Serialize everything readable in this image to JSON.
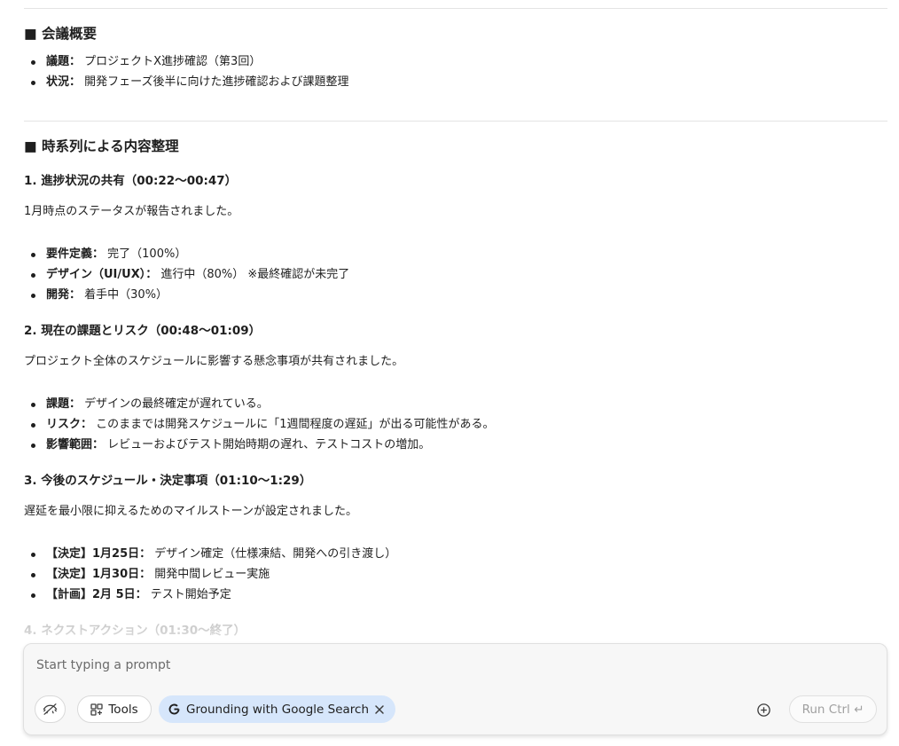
{
  "meeting_overview": {
    "heading": "■ 会議概要",
    "items": [
      {
        "label": "議題：",
        "text": "プロジェクトX進捗確認（第3回）"
      },
      {
        "label": "状況：",
        "text": "開発フェーズ後半に向けた進捗確認および課題整理"
      }
    ]
  },
  "timeline": {
    "heading": "■ 時系列による内容整理",
    "sections": [
      {
        "title": "1. 進捗状況の共有（00:22〜00:47）",
        "intro": "1月時点のステータスが報告されました。",
        "items": [
          {
            "label": "要件定義：",
            "text": "完了（100%）"
          },
          {
            "label": "デザイン（UI/UX）：",
            "text": "進行中（80%） ※最終確認が未完了"
          },
          {
            "label": "開発：",
            "text": "着手中（30%）"
          }
        ]
      },
      {
        "title": "2. 現在の課題とリスク（00:48〜01:09）",
        "intro": "プロジェクト全体のスケジュールに影響する懸念事項が共有されました。",
        "items": [
          {
            "label": "課題：",
            "text": "デザインの最終確定が遅れている。"
          },
          {
            "label": "リスク：",
            "text": "このままでは開発スケジュールに「1週間程度の遅延」が出る可能性がある。"
          },
          {
            "label": "影響範囲：",
            "text": "レビューおよびテスト開始時期の遅れ、テストコストの増加。"
          }
        ]
      },
      {
        "title": "3. 今後のスケジュール・決定事項（01:10〜1:29）",
        "intro": "遅延を最小限に抑えるためのマイルストーンが設定されました。",
        "items": [
          {
            "label": "【決定】1月25日：",
            "text": "デザイン確定（仕様凍結、開発への引き渡し）"
          },
          {
            "label": "【決定】1月30日：",
            "text": "開発中間レビュー実施"
          },
          {
            "label": "【計画】2月 5日：",
            "text": "テスト開始予定"
          }
        ]
      },
      {
        "title": "4. ネクストアクション（01:30〜終了）"
      }
    ]
  },
  "composer": {
    "placeholder": "Start typing a prompt",
    "tools_label": "Tools",
    "grounding_label": "Grounding with Google Search",
    "run_label": "Run Ctrl ↵"
  },
  "colors": {
    "chip_bg": "#d6e6fb",
    "composer_bg": "#f7f7f7",
    "text": "#1f1f1f"
  },
  "icons": {
    "visibility": "eye-off-icon",
    "tools": "grid-icon",
    "grounding": "google-g-icon",
    "remove": "close-icon",
    "add": "plus-circle-icon"
  }
}
